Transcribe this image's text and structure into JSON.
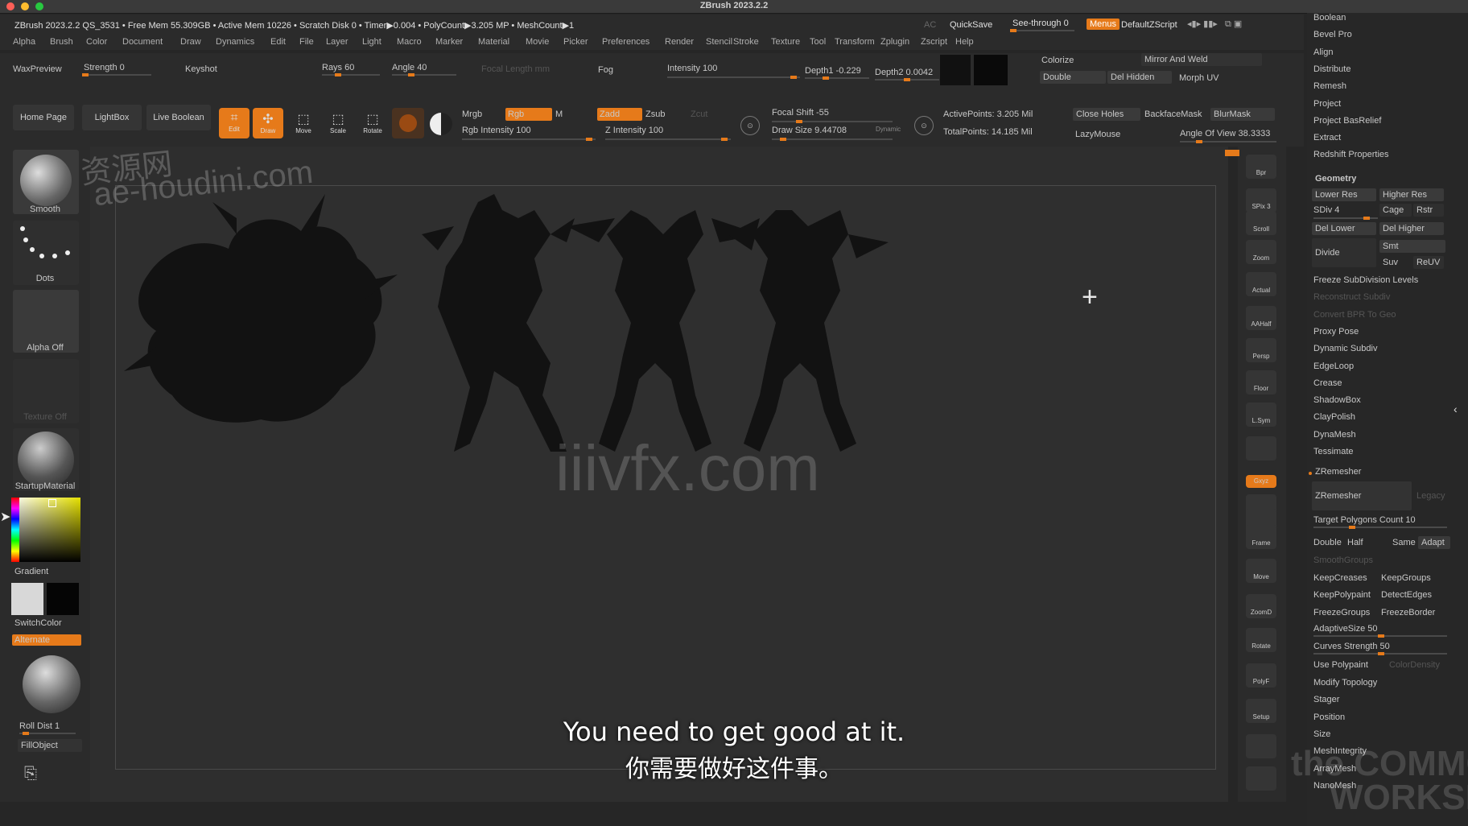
{
  "window": {
    "title": "ZBrush 2023.2.2"
  },
  "status": {
    "text": "ZBrush 2023.2.2 QS_3531   • Free Mem 55.309GB • Active Mem 10226 • Scratch Disk 0 •  Timer▶0.004 • PolyCount▶3.205 MP  • MeshCount▶1"
  },
  "topright": {
    "ac": "AC",
    "quicksave": "QuickSave",
    "see_through": "See-through  0",
    "menus": "Menus",
    "default_zscript": "DefaultZScript"
  },
  "menus": [
    "Alpha",
    "Brush",
    "Color",
    "Document",
    "Draw",
    "Dynamics",
    "Edit",
    "File",
    "Layer",
    "Light",
    "Macro",
    "Marker",
    "Material",
    "Movie",
    "Picker",
    "Preferences",
    "Render",
    "Stencil",
    "Stroke",
    "Texture",
    "Tool",
    "Transform",
    "Zplugin",
    "Zscript",
    "Help"
  ],
  "toolrow": {
    "waxpreview": "WaxPreview",
    "strength": "Strength 0",
    "keyshot": "Keyshot",
    "rays": "Rays 60",
    "angle": "Angle 40",
    "focal_length": "Focal Length mm",
    "fog": "Fog",
    "intensity": "Intensity 100",
    "depth1": "Depth1  -0.229",
    "depth2": "Depth2  0.0042",
    "colorize": "Colorize",
    "mirror_weld": "Mirror And Weld",
    "double": "Double",
    "del_hidden": "Del Hidden",
    "morph_uv": "Morph UV"
  },
  "shelf": {
    "home_page": "Home Page",
    "lightbox": "LightBox",
    "live_boolean": "Live Boolean",
    "edit": "Edit",
    "draw": "Draw",
    "move": "Move",
    "scale": "Scale",
    "rotate": "Rotate",
    "mrgb": "Mrgb",
    "rgb": "Rgb",
    "m": "M",
    "rgb_intensity": "Rgb Intensity 100",
    "zadd": "Zadd",
    "zsub": "Zsub",
    "zcut": "Zcut",
    "z_intensity": "Z Intensity 100",
    "focal_shift": "Focal Shift -55",
    "draw_size": "Draw Size 9.44708",
    "dynamic": "Dynamic",
    "active_points": "ActivePoints: 3.205 Mil",
    "total_points": "TotalPoints: 14.185 Mil",
    "close_holes": "Close Holes",
    "backface_mask": "BackfaceMask",
    "blur_mask": "BlurMask",
    "lazymouse": "LazyMouse",
    "angle_of_view": "Angle Of View 38.3333"
  },
  "left": {
    "smooth": "Smooth",
    "dots": "Dots",
    "alpha_off": "Alpha Off",
    "texture_off": "Texture Off",
    "startup_material": "StartupMaterial",
    "gradient": "Gradient",
    "switch_color": "SwitchColor",
    "alternate": "Alternate",
    "roll_dist": "Roll Dist 1",
    "fill_object": "FillObject"
  },
  "nav": [
    "Bpr",
    "SPix 3",
    "Scroll",
    "Zoom",
    "Actual",
    "AAHalf",
    "Persp",
    "Floor",
    "L.Sym",
    "",
    "Gxyz",
    "",
    "",
    "Frame",
    "Move",
    "ZoomD",
    "Rotate",
    "PolyF",
    "Setup",
    "",
    ""
  ],
  "right": {
    "top_items": [
      "Boolean",
      "Bevel Pro",
      "Align",
      "Distribute",
      "Remesh",
      "Project",
      "Project BasRelief",
      "Extract",
      "Redshift Properties"
    ],
    "geometry": "Geometry",
    "lower_res": "Lower Res",
    "higher_res": "Higher Res",
    "sdiv": "SDiv 4",
    "cage": "Cage",
    "rstr": "Rstr",
    "del_lower": "Del Lower",
    "del_higher": "Del Higher",
    "divide": "Divide",
    "smt": "Smt",
    "suv": "Suv",
    "reuv": "ReUV",
    "items_a": [
      "Freeze SubDivision Levels",
      "Reconstruct Subdiv",
      "Convert BPR To Geo",
      "Proxy Pose",
      "Dynamic Subdiv",
      "EdgeLoop",
      "Crease",
      "ShadowBox",
      "ClayPolish",
      "DynaMesh",
      "Tessimate"
    ],
    "zremesher_header": "ZRemesher",
    "zremesher_btn": "ZRemesher",
    "legacy": "Legacy",
    "target_polys": "Target Polygons Count 10",
    "double": "Double",
    "half": "Half",
    "same": "Same",
    "adapt": "Adapt",
    "smooth_groups": "SmoothGroups",
    "keep_creases": "KeepCreases",
    "keep_groups": "KeepGroups",
    "keep_polypaint": "KeepPolypaint",
    "detect_edges": "DetectEdges",
    "freeze_groups": "FreezeGroups",
    "freeze_border": "FreezeBorder",
    "adaptive_size": "AdaptiveSize 50",
    "curves_strength": "Curves Strength 50",
    "use_polypaint": "Use Polypaint",
    "color_density": "ColorDensity",
    "items_b": [
      "Modify Topology",
      "Stager",
      "Position",
      "Size",
      "MeshIntegrity",
      "ArrayMesh",
      "NanoMesh"
    ]
  },
  "subtitles": {
    "en": "You need to get good at it.",
    "zh": "你需要做好这件事。"
  },
  "watermarks": {
    "site_zh": "资源网",
    "houdini": "ae-houdini.com",
    "iiivfx": "iiivfx.com",
    "workshop_1": "the COMMON",
    "workshop_2": "WORKSHOP"
  },
  "colors": {
    "accent": "#e67a1a",
    "bg": "#262626"
  }
}
